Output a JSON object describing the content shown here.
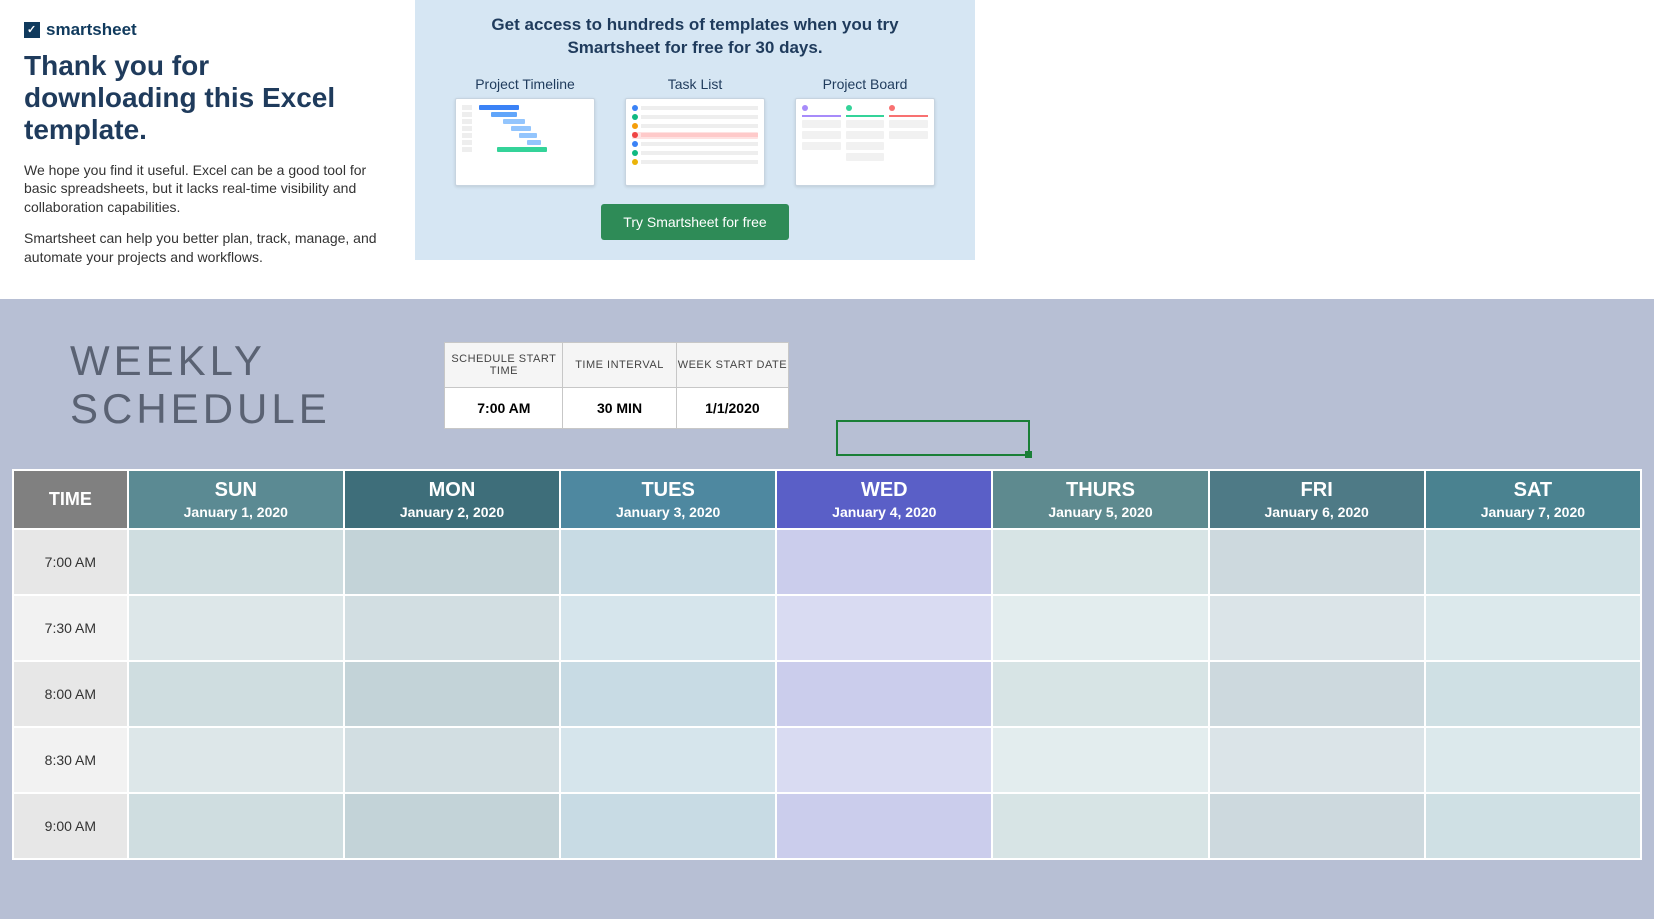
{
  "promo": {
    "brand": "smartsheet",
    "title": "Thank you for downloading this Excel template.",
    "body1": "We hope you find it useful. Excel can be a good tool for basic spreadsheets, but it lacks real-time visibility and collaboration capabilities.",
    "body2": "Smartsheet can help you better plan, track, manage, and automate your projects and workflows.",
    "headline": "Get access to hundreds of templates when you try Smartsheet for free for 30 days.",
    "thumbs": [
      "Project Timeline",
      "Task List",
      "Project Board"
    ],
    "cta": "Try Smartsheet for free"
  },
  "schedule": {
    "title": "WEEKLY SCHEDULE",
    "settings": {
      "headers": [
        "SCHEDULE START TIME",
        "TIME INTERVAL",
        "WEEK START DATE"
      ],
      "values": [
        "7:00 AM",
        "30 MIN",
        "1/1/2020"
      ]
    },
    "timeHeader": "TIME",
    "days": [
      {
        "name": "SUN",
        "date": "January 1, 2020"
      },
      {
        "name": "MON",
        "date": "January 2, 2020"
      },
      {
        "name": "TUES",
        "date": "January 3, 2020"
      },
      {
        "name": "WED",
        "date": "January 4, 2020"
      },
      {
        "name": "THURS",
        "date": "January 5, 2020"
      },
      {
        "name": "FRI",
        "date": "January 6, 2020"
      },
      {
        "name": "SAT",
        "date": "January 7, 2020"
      }
    ],
    "times": [
      "7:00 AM",
      "7:30 AM",
      "8:00 AM",
      "8:30 AM",
      "9:00 AM"
    ]
  }
}
